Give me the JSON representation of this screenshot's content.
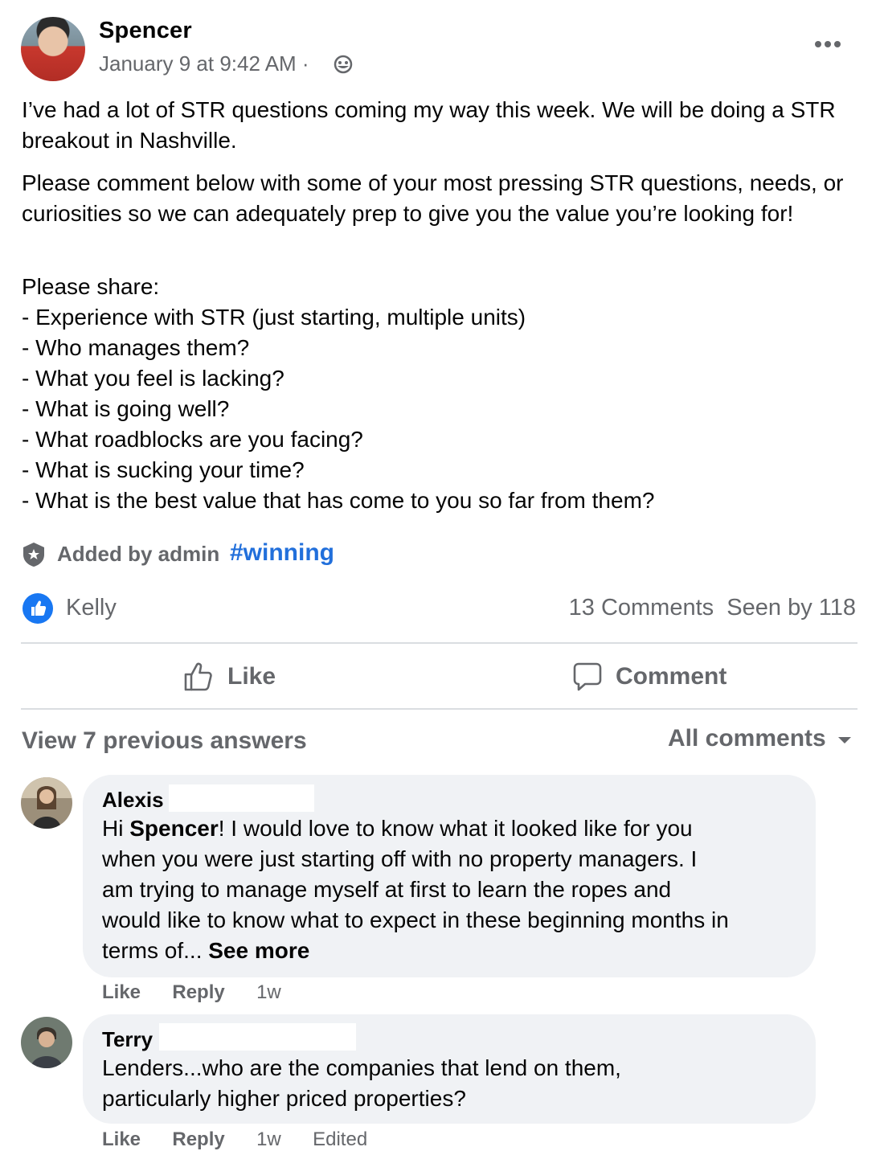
{
  "post": {
    "author": "Spencer",
    "timestamp": "January 9 at 9:42 AM ·",
    "paragraphs": [
      "I’ve had a lot of STR questions coming my way this week. We will be doing a STR breakout in Nashville.",
      "Please comment below with some of your most pressing STR questions, needs, or curiosities so we can adequately prep to give you the value you’re looking for!"
    ],
    "share_heading": "Please share:",
    "share_items": [
      "- Experience with STR (just starting, multiple units)",
      "- Who manages them?",
      "- What you feel is lacking?",
      "- What is going well?",
      "- What roadblocks are you facing?",
      "- What is sucking your time?",
      "- What is the best value that has come to you so far from them?"
    ],
    "admin_label": "Added by admin",
    "hashtag": "#winning",
    "reactor": "Kelly",
    "comments_count": "13 Comments",
    "seen_by": "Seen by 118"
  },
  "actions": {
    "like": "Like",
    "comment": "Comment"
  },
  "comments_header": {
    "view_previous": "View 7 previous answers",
    "filter": "All comments"
  },
  "comments": [
    {
      "name": "Alexis",
      "greeting_prefix": "Hi ",
      "greeting_name": "Spencer",
      "text_after_name": "! I would love to know what it looked like for you",
      "lines": [
        "when you were just starting off with no property managers. I",
        "am trying to manage myself at first to learn the ropes and",
        "would like to know what to expect in these beginning months in"
      ],
      "last_line": "terms of... ",
      "see_more": "See more",
      "like": "Like",
      "reply": "Reply",
      "time": "1w"
    },
    {
      "name": "Terry",
      "lines": [
        "Lenders...who are the companies that lend on them,",
        "particularly higher priced properties?"
      ],
      "like": "Like",
      "reply": "Reply",
      "time": "1w",
      "edited": "Edited"
    }
  ],
  "colors": {
    "accent": "#1877f2",
    "hashtag": "#216fdb",
    "secondary_text": "#65676b",
    "bubble": "#f0f2f5"
  },
  "icons": [
    "globe-icon",
    "more-options-icon",
    "admin-shield-icon",
    "like-reaction-icon",
    "thumbs-up-icon",
    "comment-bubble-icon",
    "caret-down-icon"
  ]
}
